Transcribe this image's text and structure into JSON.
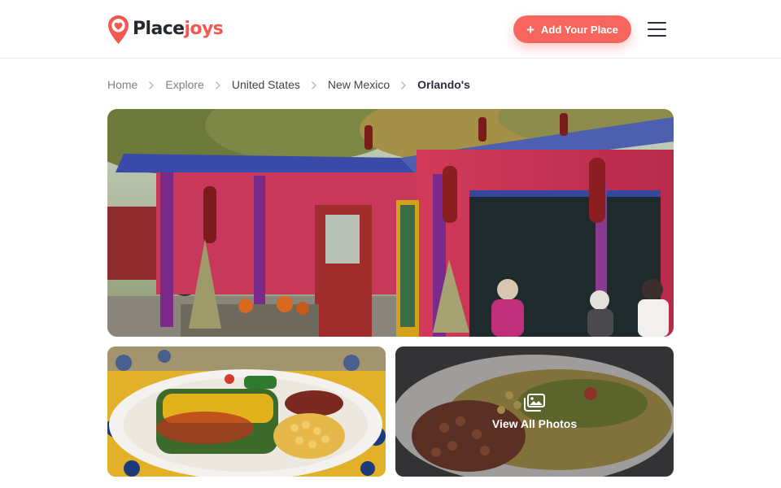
{
  "brand": {
    "name_part1": "Place",
    "name_part2": "joys",
    "accent": "#f4574f"
  },
  "header": {
    "add_place_label": "Add Your Place",
    "add_icon": "plus-icon",
    "menu_icon": "hamburger-menu-icon"
  },
  "breadcrumb": {
    "items": [
      "Home",
      "Explore",
      "United States",
      "New Mexico",
      "Orlando's"
    ],
    "separator_icon": "chevron-right-icon"
  },
  "gallery": {
    "hero_alt": "Orlando's restaurant exterior with red chile ristras",
    "photo2_alt": "Plate of enchiladas with beans and hominy",
    "photo3_alt": "Plate of enchiladas with beans",
    "view_all_label": "View All Photos",
    "view_all_icon": "images-icon"
  }
}
